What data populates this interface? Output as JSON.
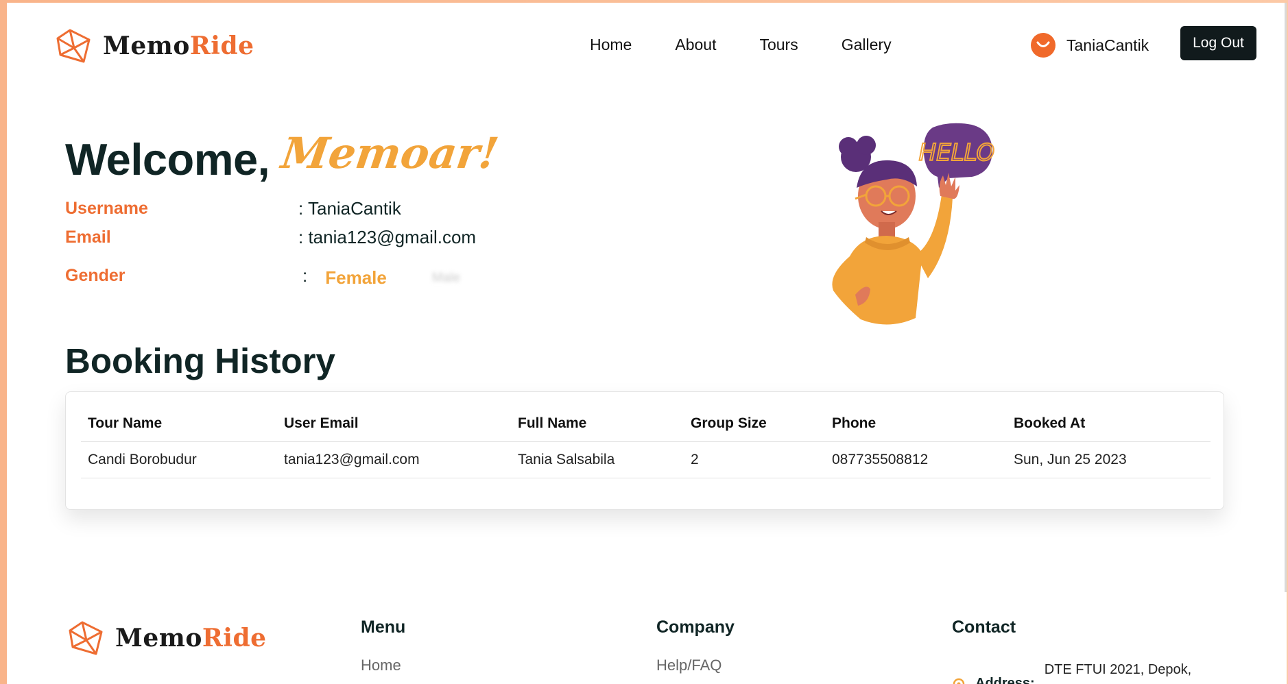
{
  "nav": {
    "brand_main": "Memo",
    "brand_accent": "Ride",
    "links": [
      "Home",
      "About",
      "Tours",
      "Gallery"
    ],
    "username": "TaniaCantik",
    "logout_label": "Log Out"
  },
  "welcome": {
    "greeting": "Welcome,",
    "name": "Memoar!"
  },
  "profile": {
    "username_label": "Username",
    "username_value": ": TaniaCantik",
    "email_label": "Email",
    "email_value": ": tania123@gmail.com",
    "gender_label": "Gender",
    "gender_colon": ":",
    "gender_selected": "Female",
    "gender_other": "Male"
  },
  "illustration": {
    "speech_text": "HELLO"
  },
  "booking": {
    "title": "Booking History",
    "columns": [
      "Tour Name",
      "User Email",
      "Full Name",
      "Group Size",
      "Phone",
      "Booked At"
    ],
    "rows": [
      [
        "Candi Borobudur",
        "tania123@gmail.com",
        "Tania Salsabila",
        "2",
        "087735508812",
        "Sun, Jun 25 2023"
      ]
    ]
  },
  "footer": {
    "brand_main": "Memo",
    "brand_accent": "Ride",
    "menu_title": "Menu",
    "menu_first": "Home",
    "company_title": "Company",
    "company_first": "Help/FAQ",
    "contact_title": "Contact",
    "address_label": "Address:",
    "address_value": "DTE FTUI 2021, Depok,"
  },
  "colors": {
    "accent_orange": "#ee6d32",
    "accent_yellow": "#f2a43a",
    "button_dark": "#111a1c",
    "text_dark": "#102525"
  }
}
